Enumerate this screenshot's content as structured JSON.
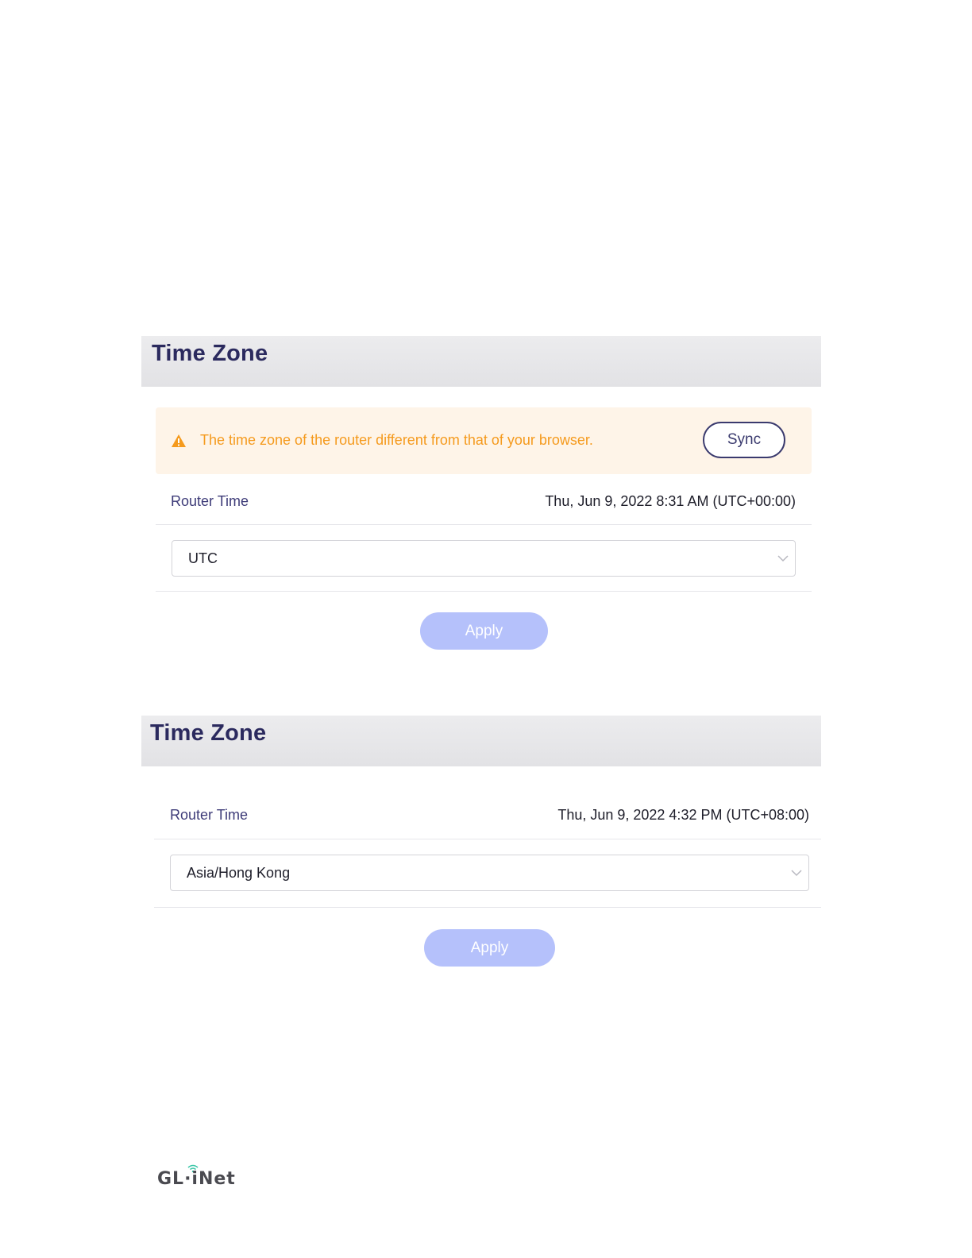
{
  "panel1": {
    "title": "Time Zone",
    "alert": {
      "icon": "warning-icon",
      "text": "The time zone of the router different from that of your browser.",
      "sync_label": "Sync"
    },
    "router_time_label": "Router Time",
    "router_time_value": "Thu, Jun 9, 2022 8:31 AM (UTC+00:00)",
    "timezone_select_value": "UTC",
    "apply_label": "Apply"
  },
  "panel2": {
    "title": "Time Zone",
    "router_time_label": "Router Time",
    "router_time_value": "Thu, Jun 9, 2022 4:32 PM (UTC+08:00)",
    "timezone_select_value": "Asia/Hong Kong",
    "apply_label": "Apply"
  },
  "footer": {
    "logo_text": "GL·iNet"
  },
  "colors": {
    "title": "#2b2a5e",
    "warning": "#f59a1d",
    "alert_bg": "#fef4e8",
    "apply_disabled": "#b5c1fb"
  }
}
